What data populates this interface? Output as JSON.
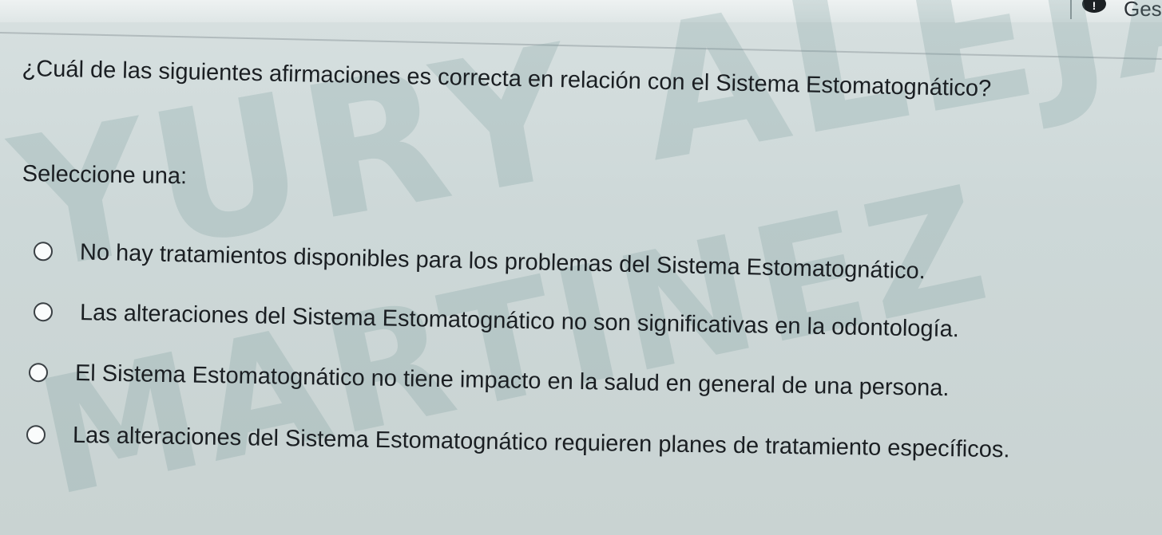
{
  "header": {
    "text": "Ges",
    "badge": "!"
  },
  "watermark": {
    "line1": "YURY ALEJANDRA ME",
    "line2": "MARTINEZ"
  },
  "question": {
    "text": "¿Cuál de las siguientes afirmaciones es correcta en relación con el Sistema Estomatognático?",
    "prompt": "Seleccione una:",
    "options": [
      {
        "label": "No hay tratamientos disponibles para los problemas del Sistema Estomatognático.",
        "selected": false
      },
      {
        "label": "Las alteraciones del Sistema Estomatognático no son significativas en la odontología.",
        "selected": false
      },
      {
        "label": "El Sistema Estomatognático no tiene impacto en la salud en general de una persona.",
        "selected": false
      },
      {
        "label": "Las alteraciones del Sistema Estomatognático requieren planes de tratamiento específicos.",
        "selected": false
      }
    ]
  }
}
